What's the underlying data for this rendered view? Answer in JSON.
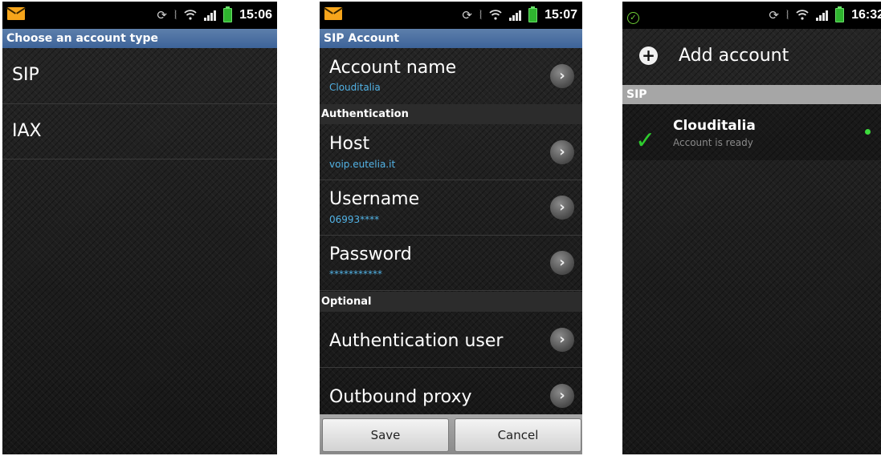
{
  "screen1": {
    "status": {
      "time": "15:06"
    },
    "title": "Choose an account type",
    "items": [
      {
        "label": "SIP"
      },
      {
        "label": "IAX"
      }
    ]
  },
  "screen2": {
    "status": {
      "time": "15:07"
    },
    "title": "SIP Account",
    "account_name": {
      "label": "Account name",
      "value": "Clouditalia"
    },
    "sections": {
      "authentication": "Authentication",
      "optional": "Optional"
    },
    "host": {
      "label": "Host",
      "value": "voip.eutelia.it"
    },
    "username": {
      "label": "Username",
      "value": "06993****"
    },
    "password": {
      "label": "Password",
      "value": "***********"
    },
    "auth_user": {
      "label": "Authentication user"
    },
    "outbound_proxy": {
      "label": "Outbound proxy"
    },
    "buttons": {
      "save": "Save",
      "cancel": "Cancel"
    }
  },
  "screen3": {
    "status": {
      "time": "16:32"
    },
    "add_account": "Add account",
    "section": "SIP",
    "account": {
      "name": "Clouditalia",
      "status": "Account is ready"
    }
  },
  "icons": {
    "notification": "email-icon",
    "ok": "check-circle-icon",
    "sync": "sync-icon",
    "vibrate": "vibrate-icon",
    "wifi": "wifi-icon",
    "signal": "signal-icon",
    "battery": "battery-icon",
    "chevron": "chevron-right-icon",
    "add": "add-circle-icon",
    "check": "check-icon",
    "online": "online-dot-icon"
  },
  "colors": {
    "title_bar": "#4a6fa5",
    "subtitle_blue": "#52b3e6",
    "battery_green": "#2fb52f",
    "check_green": "#2ecc2e",
    "envelope_orange": "#f7a51b"
  }
}
